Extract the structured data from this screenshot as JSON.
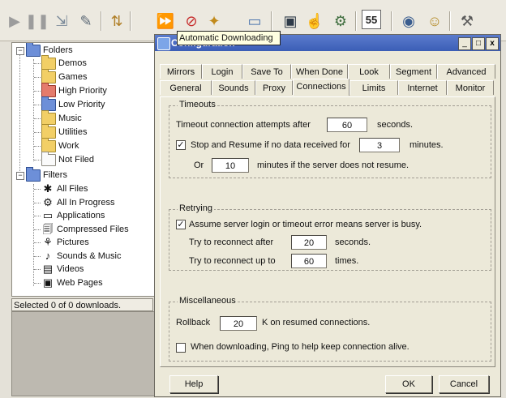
{
  "toolbar": {
    "buttons": [
      {
        "icon": "play-icon",
        "glyph": "▶",
        "color": "#9c9c9c"
      },
      {
        "icon": "pause-icon",
        "glyph": "❚❚",
        "color": "#9c9c9c"
      },
      {
        "icon": "import-icon",
        "glyph": "⇲",
        "color": "#7b8a99"
      },
      {
        "icon": "edit-icon",
        "glyph": "✎",
        "color": "#5d6a77"
      },
      {
        "icon": "sort-icon",
        "glyph": "⇅",
        "color": "#b07f27"
      },
      {
        "icon": "automatic-download-icon",
        "glyph": "⏩",
        "color": "#2c5aa0"
      },
      {
        "icon": "stop-schedule-icon",
        "glyph": "⊘",
        "color": "#c62a2a"
      },
      {
        "icon": "wizard-icon",
        "glyph": "✦",
        "color": "#c18a1b"
      },
      {
        "icon": "monitor-icon",
        "glyph": "▭",
        "color": "#4a74ad"
      },
      {
        "icon": "screen-icon",
        "glyph": "▣",
        "color": "#2f3b49"
      },
      {
        "icon": "hand-icon",
        "glyph": "☝",
        "color": "#c99c2c"
      },
      {
        "icon": "search-icon",
        "glyph": "⚙",
        "color": "#3e6d3e"
      },
      {
        "icon": "counter-icon",
        "glyph": "55",
        "color": "#222222"
      },
      {
        "icon": "target-icon",
        "glyph": "◉",
        "color": "#3a5d8f"
      },
      {
        "icon": "help-icon",
        "glyph": "☺",
        "color": "#b48a25"
      },
      {
        "icon": "tools-icon",
        "glyph": "⚒",
        "color": "#5a5a5a"
      }
    ],
    "tooltip": "Automatic Downloading"
  },
  "tree": {
    "folders_label": "Folders",
    "folders": [
      {
        "label": "Demos",
        "style": "yellow"
      },
      {
        "label": "Games",
        "style": "yellow"
      },
      {
        "label": "High Priority",
        "style": "red"
      },
      {
        "label": "Low Priority",
        "style": "blue"
      },
      {
        "label": "Music",
        "style": "yellow"
      },
      {
        "label": "Utilities",
        "style": "yellow"
      },
      {
        "label": "Work",
        "style": "yellow"
      },
      {
        "label": "Not Filed",
        "style": "white"
      }
    ],
    "filters_label": "Filters",
    "filters": [
      {
        "label": "All Files",
        "icon": "all-files-icon",
        "glyph": "✱"
      },
      {
        "label": "All In Progress",
        "icon": "in-progress-icon",
        "glyph": "⚙"
      },
      {
        "label": "Applications",
        "icon": "applications-icon",
        "glyph": "▭"
      },
      {
        "label": "Compressed Files",
        "icon": "compressed-files-icon",
        "glyph": "🗐"
      },
      {
        "label": "Pictures",
        "icon": "pictures-icon",
        "glyph": "⚘"
      },
      {
        "label": "Sounds & Music",
        "icon": "sounds-music-icon",
        "glyph": "♪"
      },
      {
        "label": "Videos",
        "icon": "videos-icon",
        "glyph": "▤"
      },
      {
        "label": "Web Pages",
        "icon": "web-pages-icon",
        "glyph": "▣"
      }
    ]
  },
  "status": "Selected 0 of 0 downloads.",
  "dialog": {
    "title": "Configuration",
    "minimize_label": "_",
    "maximize_label": "□",
    "close_label": "x",
    "tabs_row1": [
      "Mirrors",
      "Login",
      "Save To",
      "When Done",
      "Look",
      "Segment",
      "Advanced"
    ],
    "tabs_row2": [
      "General",
      "Sounds",
      "Proxy",
      "Connections",
      "Limits",
      "Internet",
      "Monitor"
    ],
    "active_tab": "Connections",
    "timeouts": {
      "title": "Timeouts",
      "attempts_prefix": "Timeout connection attempts after",
      "attempts_value": "60",
      "attempts_suffix": "seconds.",
      "stop_resume_label": "Stop and Resume if no data received for",
      "stop_resume_checked": "✓",
      "stop_resume_value": "3",
      "stop_resume_suffix": "minutes.",
      "or_label": "Or",
      "or_value": "10",
      "or_suffix": "minutes if the server does not resume."
    },
    "retrying": {
      "title": "Retrying",
      "assume_label": "Assume server login or timeout error means server is busy.",
      "assume_checked": "✓",
      "reconnect_after_label": "Try to reconnect after",
      "reconnect_after_value": "20",
      "reconnect_after_suffix": "seconds.",
      "reconnect_up_label": "Try to reconnect up to",
      "reconnect_up_value": "60",
      "reconnect_up_suffix": "times."
    },
    "misc": {
      "title": "Miscellaneous",
      "rollback_label": "Rollback",
      "rollback_value": "20",
      "rollback_suffix": "K on resumed connections.",
      "ping_label": "When downloading, Ping to help keep connection alive.",
      "ping_checked": ""
    },
    "buttons": {
      "help": "Help",
      "ok": "OK",
      "cancel": "Cancel"
    }
  }
}
